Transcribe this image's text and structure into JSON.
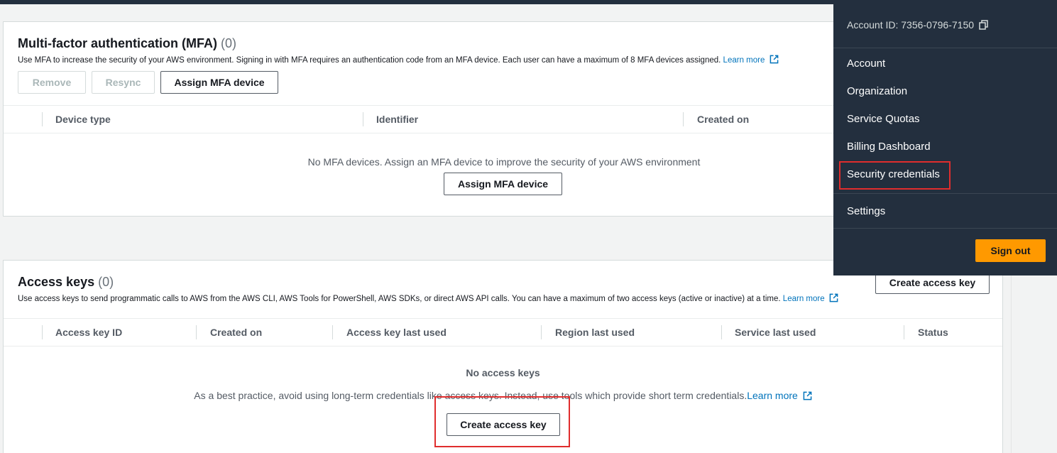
{
  "mfa": {
    "title": "Multi-factor authentication (MFA)",
    "count": "(0)",
    "description": "Use MFA to increase the security of your AWS environment. Signing in with MFA requires an authentication code from an MFA device. Each user can have a maximum of 8 MFA devices assigned.",
    "learn_more": "Learn more",
    "buttons": {
      "remove": "Remove",
      "resync": "Resync",
      "assign": "Assign MFA device"
    },
    "columns": [
      "Device type",
      "Identifier",
      "Created on"
    ],
    "empty_message": "No MFA devices. Assign an MFA device to improve the security of your AWS environment",
    "empty_button": "Assign MFA device"
  },
  "access_keys": {
    "title": "Access keys",
    "count": "(0)",
    "description": "Use access keys to send programmatic calls to AWS from the AWS CLI, AWS Tools for PowerShell, AWS SDKs, or direct AWS API calls. You can have a maximum of two access keys (active or inactive) at a time.",
    "learn_more": "Learn more",
    "create_button": "Create access key",
    "columns": [
      "Access key ID",
      "Created on",
      "Access key last used",
      "Region last used",
      "Service last used",
      "Status"
    ],
    "empty_title": "No access keys",
    "empty_message": "As a best practice, avoid using long-term credentials like access keys. Instead, use tools which provide short term credentials.",
    "empty_learn_more": "Learn more",
    "empty_button": "Create access key"
  },
  "account_menu": {
    "account_id": "Account ID: 7356-0796-7150",
    "items": [
      "Account",
      "Organization",
      "Service Quotas",
      "Billing Dashboard",
      "Security credentials",
      "Settings"
    ],
    "sign_out": "Sign out"
  },
  "colors": {
    "accent_link": "#0073bb",
    "menu_bg": "#232f3e",
    "sign_out_bg": "#ff9900",
    "highlight": "#e02d2d"
  }
}
